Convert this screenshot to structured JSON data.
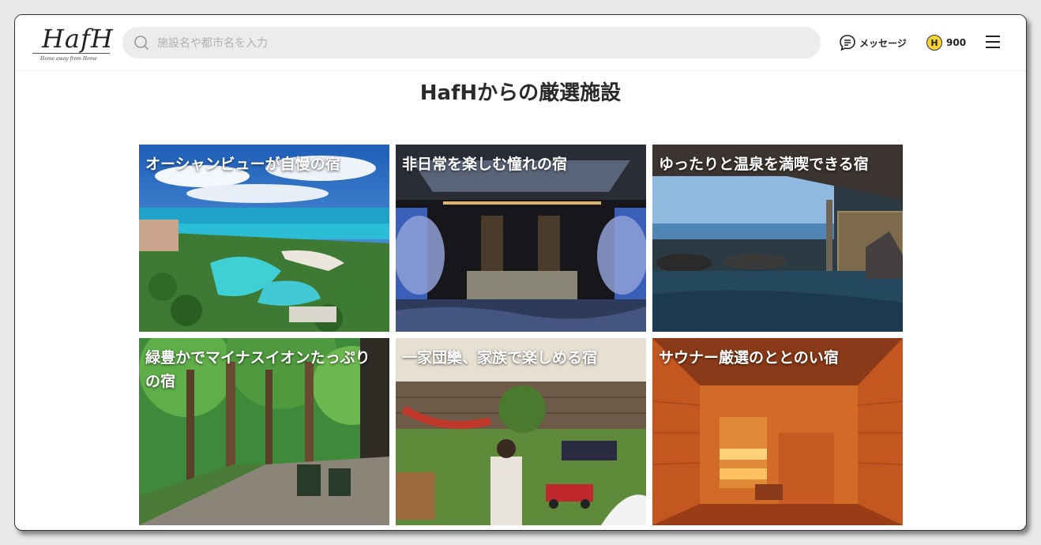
{
  "header": {
    "logo": "HafH",
    "logo_tagline": "Home away from Home",
    "search_placeholder": "施設名や都市名を入力",
    "messages_label": "メッセージ",
    "coin_letter": "H",
    "points": "900"
  },
  "main": {
    "title": "HafHからの厳選施設",
    "cards": [
      {
        "label": "オーシャンビューが自慢の宿"
      },
      {
        "label": "非日常を楽しむ憧れの宿"
      },
      {
        "label": "ゆったりと温泉を満喫できる宿"
      },
      {
        "label": "緑豊かでマイナスイオンたっぷりの宿"
      },
      {
        "label": "一家団欒、家族で楽しめる宿"
      },
      {
        "label": "サウナー厳選のととのい宿"
      }
    ]
  },
  "colors": {
    "coin": "#f6d437",
    "search_bg": "#ececec"
  }
}
